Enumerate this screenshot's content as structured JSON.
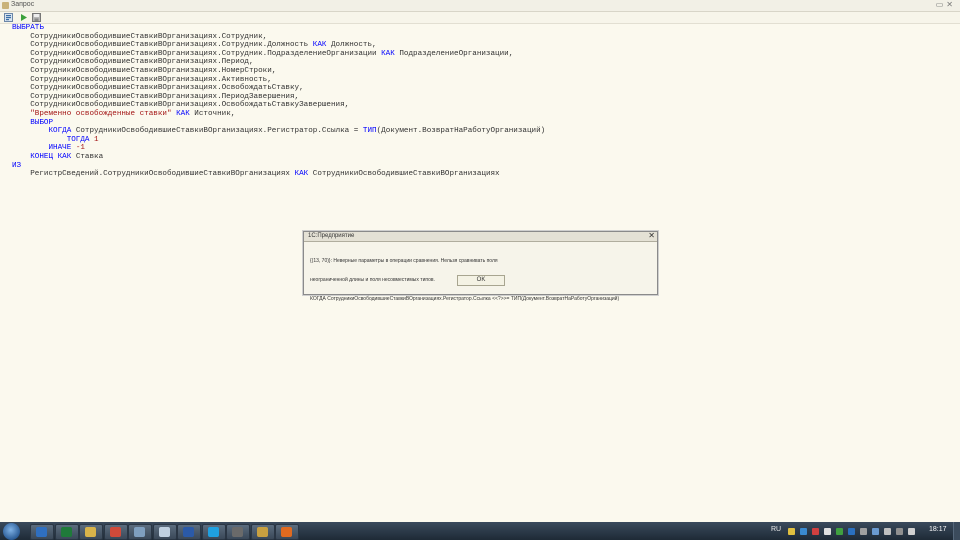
{
  "window": {
    "title": "Запрос"
  },
  "editor": {
    "lines": [
      [
        {
          "t": "ВЫБРАТЬ",
          "c": "kw"
        }
      ],
      [
        {
          "t": "    СотрудникиОсвободившиеСтавкиВОрганизациях.Сотрудник,",
          "c": ""
        }
      ],
      [
        {
          "t": "    СотрудникиОсвободившиеСтавкиВОрганизациях.Сотрудник.Должность ",
          "c": ""
        },
        {
          "t": "КАК",
          "c": "kw"
        },
        {
          "t": " Должность,",
          "c": ""
        }
      ],
      [
        {
          "t": "    СотрудникиОсвободившиеСтавкиВОрганизациях.Сотрудник.ПодразделениеОрганизации ",
          "c": ""
        },
        {
          "t": "КАК",
          "c": "kw"
        },
        {
          "t": " ПодразделениеОрганизации,",
          "c": ""
        }
      ],
      [
        {
          "t": "    СотрудникиОсвободившиеСтавкиВОрганизациях.Период,",
          "c": ""
        }
      ],
      [
        {
          "t": "    СотрудникиОсвободившиеСтавкиВОрганизациях.НомерСтроки,",
          "c": ""
        }
      ],
      [
        {
          "t": "    СотрудникиОсвободившиеСтавкиВОрганизациях.Активность,",
          "c": ""
        }
      ],
      [
        {
          "t": "    СотрудникиОсвободившиеСтавкиВОрганизациях.ОсвобождатьСтавку,",
          "c": ""
        }
      ],
      [
        {
          "t": "    СотрудникиОсвободившиеСтавкиВОрганизациях.ПериодЗавершения,",
          "c": ""
        }
      ],
      [
        {
          "t": "    СотрудникиОсвободившиеСтавкиВОрганизациях.ОсвобождатьСтавкуЗавершения,",
          "c": ""
        }
      ],
      [
        {
          "t": "    ",
          "c": ""
        },
        {
          "t": "\"Временно освобожденные ставки\"",
          "c": "str"
        },
        {
          "t": " ",
          "c": ""
        },
        {
          "t": "КАК",
          "c": "kw"
        },
        {
          "t": " Источник,",
          "c": ""
        }
      ],
      [
        {
          "t": "    ",
          "c": ""
        },
        {
          "t": "ВЫБОР",
          "c": "kw"
        }
      ],
      [
        {
          "t": "        ",
          "c": ""
        },
        {
          "t": "КОГДА",
          "c": "kw"
        },
        {
          "t": " СотрудникиОсвободившиеСтавкиВОрганизациях.Регистратор.Ссылка = ",
          "c": ""
        },
        {
          "t": "ТИП",
          "c": "kw"
        },
        {
          "t": "(Документ.ВозвратНаРаботуОрганизаций)",
          "c": ""
        }
      ],
      [
        {
          "t": "            ",
          "c": ""
        },
        {
          "t": "ТОГДА",
          "c": "kw"
        },
        {
          "t": " ",
          "c": ""
        },
        {
          "t": "1",
          "c": "num"
        }
      ],
      [
        {
          "t": "        ",
          "c": ""
        },
        {
          "t": "ИНАЧЕ",
          "c": "kw"
        },
        {
          "t": " ",
          "c": ""
        },
        {
          "t": "-1",
          "c": "num"
        }
      ],
      [
        {
          "t": "    ",
          "c": ""
        },
        {
          "t": "КОНЕЦ",
          "c": "kw"
        },
        {
          "t": " ",
          "c": ""
        },
        {
          "t": "КАК",
          "c": "kw"
        },
        {
          "t": " Ставка",
          "c": ""
        }
      ],
      [
        {
          "t": "ИЗ",
          "c": "kw"
        }
      ],
      [
        {
          "t": "    РегистрСведений.СотрудникиОсвободившиеСтавкиВОрганизациях ",
          "c": ""
        },
        {
          "t": "КАК",
          "c": "kw"
        },
        {
          "t": " СотрудникиОсвободившиеСтавкиВОрганизациях",
          "c": ""
        }
      ]
    ]
  },
  "dialog": {
    "title": "1С:Предприятие",
    "message_lines": [
      "{(13, 70)}: Неверные параметры в операции сравнения. Нельзя сравнивать поля",
      "неограниченной длины и поля несовместимых типов.",
      "КОГДА СотрудникиОсвободившиеСтавкиВОрганизациях.Регистратор.Ссылка <<?>>= ТИП(Документ.ВозвратНаРаботуОрганизаций)"
    ],
    "ok_label": "OK",
    "close_label": "✕"
  },
  "taskbar": {
    "items": [
      {
        "name": "1c-task",
        "color": "#2f6fc0"
      },
      {
        "name": "excel-task",
        "color": "#1f7a3a"
      },
      {
        "name": "explorer-task",
        "color": "#d8b34a"
      },
      {
        "name": "chrome-task",
        "color": "#d04a3a"
      },
      {
        "name": "files-task",
        "color": "#7f9fbf"
      },
      {
        "name": "browser-task",
        "color": "#c0d0e0"
      },
      {
        "name": "word-task",
        "color": "#2b5aa8"
      },
      {
        "name": "skype-task",
        "color": "#1fa0e0"
      },
      {
        "name": "calc-task",
        "color": "#6a6a6a"
      },
      {
        "name": "paint-task",
        "color": "#c8a040"
      },
      {
        "name": "media-task",
        "color": "#e06a20"
      }
    ],
    "language": "RU",
    "clock": "18:17"
  }
}
